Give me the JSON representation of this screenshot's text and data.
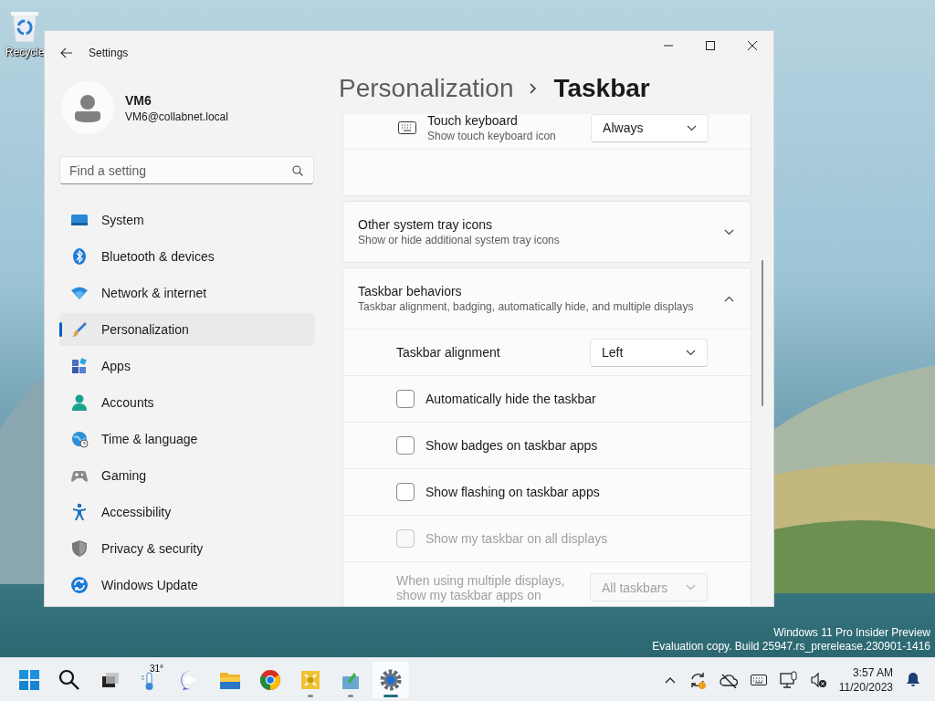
{
  "desktop": {
    "icons": [
      {
        "label": "Recycle"
      }
    ],
    "build_info": [
      "Windows 11 Pro Insider Preview",
      "Evaluation copy. Build 25947.rs_prerelease.230901-1416"
    ]
  },
  "window": {
    "title": "Settings"
  },
  "user": {
    "name": "VM6",
    "email": "VM6@collabnet.local"
  },
  "search": {
    "placeholder": "Find a setting"
  },
  "nav": [
    {
      "label": "System",
      "selected": false
    },
    {
      "label": "Bluetooth & devices",
      "selected": false
    },
    {
      "label": "Network & internet",
      "selected": false
    },
    {
      "label": "Personalization",
      "selected": true
    },
    {
      "label": "Apps",
      "selected": false
    },
    {
      "label": "Accounts",
      "selected": false
    },
    {
      "label": "Time & language",
      "selected": false
    },
    {
      "label": "Gaming",
      "selected": false
    },
    {
      "label": "Accessibility",
      "selected": false
    },
    {
      "label": "Privacy & security",
      "selected": false
    },
    {
      "label": "Windows Update",
      "selected": false
    }
  ],
  "breadcrumb": [
    "Personalization",
    "Taskbar"
  ],
  "touch_keyboard": {
    "title": "Touch keyboard",
    "subtitle": "Show touch keyboard icon",
    "value": "Always"
  },
  "cards": [
    {
      "title": "Other system tray icons",
      "subtitle": "Show or hide additional system tray icons",
      "expanded": false
    },
    {
      "title": "Taskbar behaviors",
      "subtitle": "Taskbar alignment, badging, automatically hide, and multiple displays",
      "expanded": true
    }
  ],
  "behaviors": [
    {
      "kind": "dropdown",
      "label": "Taskbar alignment",
      "value": "Left",
      "disabled": false
    },
    {
      "kind": "checkbox",
      "label": "Automatically hide the taskbar",
      "checked": false,
      "disabled": false
    },
    {
      "kind": "checkbox",
      "label": "Show badges on taskbar apps",
      "checked": false,
      "disabled": false
    },
    {
      "kind": "checkbox",
      "label": "Show flashing on taskbar apps",
      "checked": false,
      "disabled": false
    },
    {
      "kind": "checkbox",
      "label": "Show my taskbar on all displays",
      "checked": false,
      "disabled": true
    },
    {
      "kind": "dropdown",
      "label": "When using multiple displays, show my taskbar apps on",
      "value": "All taskbars",
      "disabled": true
    }
  ],
  "taskbar": {
    "weather": "31°",
    "apps": [
      {
        "running": false,
        "active": false
      },
      {
        "running": false,
        "active": false
      },
      {
        "running": false,
        "active": false
      },
      {
        "running": false,
        "active": false
      },
      {
        "running": false,
        "active": false
      },
      {
        "running": false,
        "active": false
      },
      {
        "running": false,
        "active": false
      },
      {
        "running": true,
        "active": false
      },
      {
        "running": true,
        "active": false
      },
      {
        "running": true,
        "active": true
      }
    ],
    "time": "3:57 AM",
    "date": "11/20/2023"
  }
}
